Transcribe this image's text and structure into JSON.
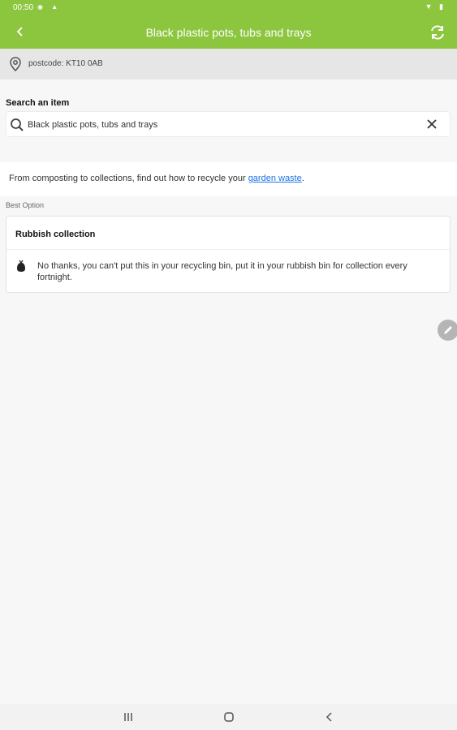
{
  "status_bar": {
    "time": "00:50"
  },
  "app_bar": {
    "title": "Black plastic pots, tubs and trays"
  },
  "location": {
    "postcode": "postcode: KT10 0AB"
  },
  "search": {
    "label": "Search an item",
    "value": "Black plastic pots, tubs and trays"
  },
  "info": {
    "text": "From composting to collections, find out how to recycle your ",
    "link_text": "garden waste",
    "suffix": "."
  },
  "best_option": {
    "label": "Best Option",
    "card_title": "Rubbish collection",
    "description": "No thanks, you can't put this in your recycling bin, put it in your rubbish bin for collection every fortnight."
  },
  "colors": {
    "header_green": "#8cc63f",
    "link_blue": "#1a73e8"
  }
}
